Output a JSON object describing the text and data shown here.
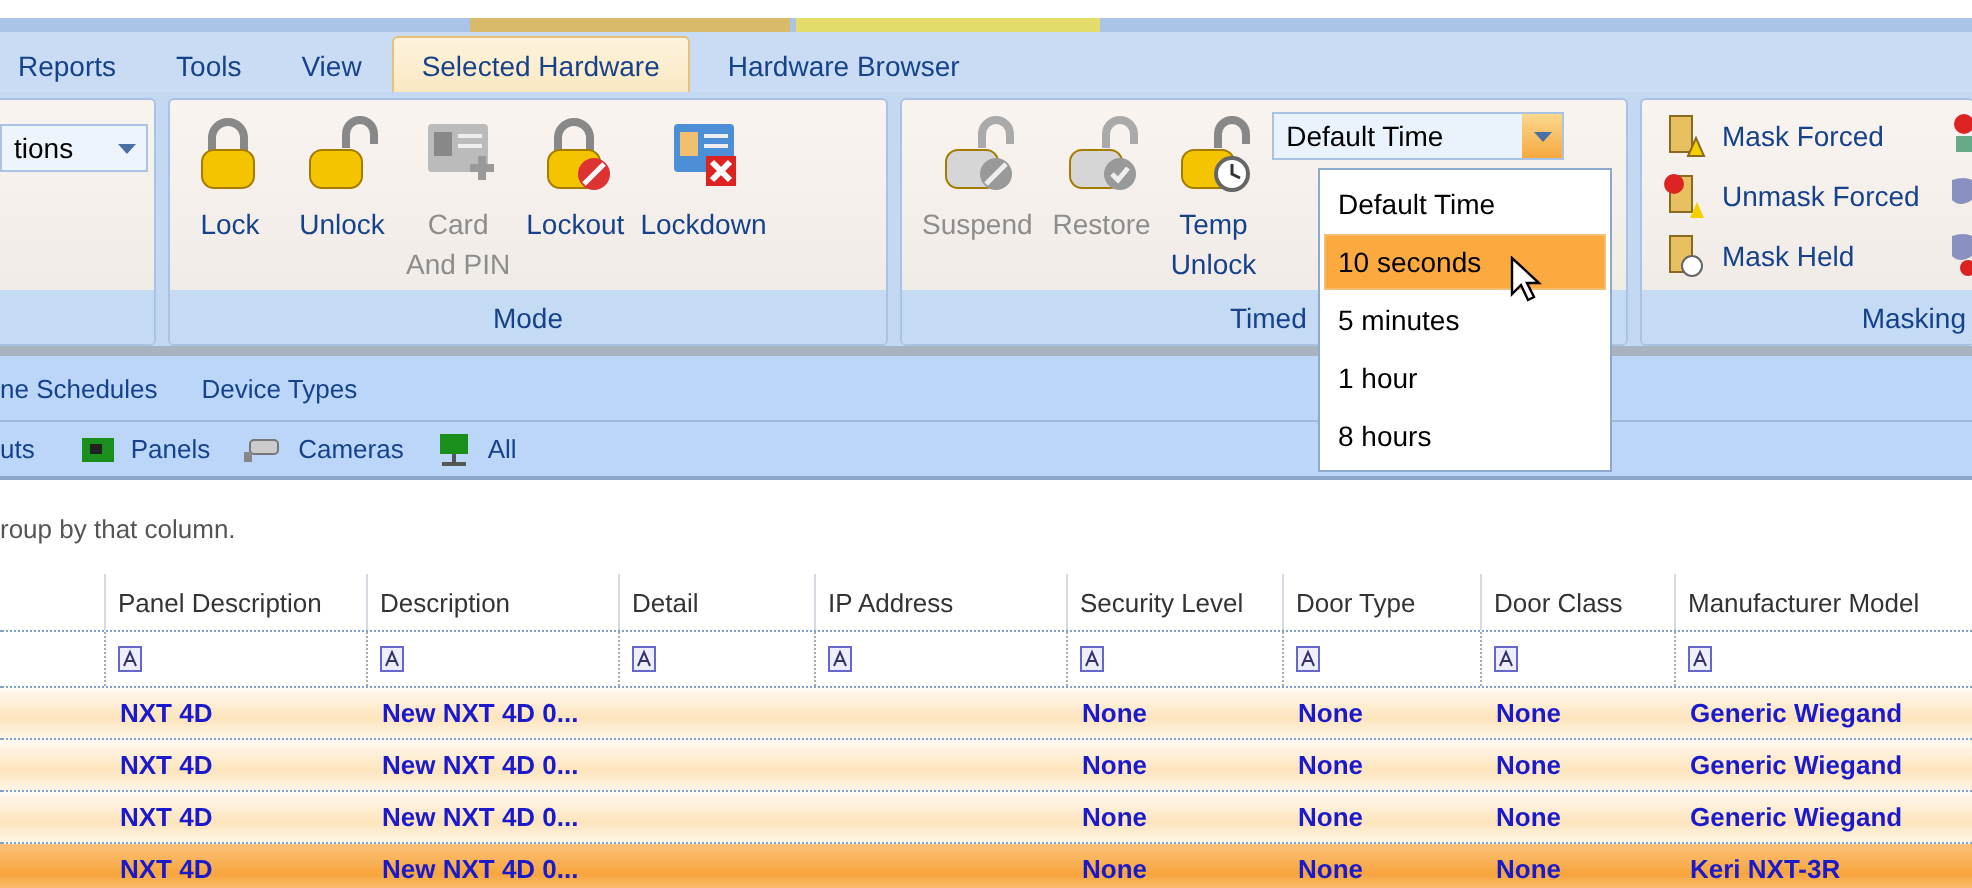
{
  "tabs": [
    {
      "label": "Reports",
      "selected": false
    },
    {
      "label": "Tools",
      "selected": false
    },
    {
      "label": "View",
      "selected": false
    },
    {
      "label": "Selected Hardware",
      "selected": true
    },
    {
      "label": "Hardware Browser",
      "selected": false
    }
  ],
  "ribbon": {
    "partial_dropdown": {
      "value": "tions"
    },
    "mode_group": {
      "label": "Mode",
      "buttons": [
        {
          "label": "Lock",
          "disabled": false
        },
        {
          "label": "Unlock",
          "disabled": false
        },
        {
          "label": "Card\nAnd PIN",
          "disabled": true
        },
        {
          "label": "Lockout",
          "disabled": false
        },
        {
          "label": "Lockdown",
          "disabled": false
        }
      ]
    },
    "timed_group": {
      "label": "Timed",
      "buttons": [
        {
          "label": "Suspend",
          "disabled": true
        },
        {
          "label": "Restore",
          "disabled": true
        },
        {
          "label": "Temp\nUnlock",
          "disabled": false
        }
      ],
      "dropdown": {
        "value": "Default Time",
        "open": true,
        "options": [
          {
            "label": "Default Time",
            "highlighted": false
          },
          {
            "label": "10 seconds",
            "highlighted": true
          },
          {
            "label": "5 minutes",
            "highlighted": false
          },
          {
            "label": "1 hour",
            "highlighted": false
          },
          {
            "label": "8 hours",
            "highlighted": false
          }
        ]
      }
    },
    "masking_group": {
      "label": "Masking",
      "items": [
        {
          "label": "Mask Forced"
        },
        {
          "label": "Unmask Forced"
        },
        {
          "label": "Mask Held"
        }
      ]
    }
  },
  "nav_tabs": [
    "ne Schedules",
    "Device Types"
  ],
  "toolbar": [
    "uts",
    "Panels",
    "Cameras",
    "All"
  ],
  "group_hint": "roup by that column.",
  "table": {
    "columns": [
      "Panel Description",
      "Description",
      "Detail",
      "IP Address",
      "Security Level",
      "Door Type",
      "Door Class",
      "Manufacturer Model"
    ],
    "rows": [
      {
        "cells": [
          "NXT 4D",
          "New NXT 4D 0...",
          "",
          "",
          "None",
          "None",
          "None",
          "Generic Wiegand"
        ],
        "selected": false
      },
      {
        "cells": [
          "NXT 4D",
          "New NXT 4D 0...",
          "",
          "",
          "None",
          "None",
          "None",
          "Generic Wiegand"
        ],
        "selected": false
      },
      {
        "cells": [
          "NXT 4D",
          "New NXT 4D 0...",
          "",
          "",
          "None",
          "None",
          "None",
          "Generic Wiegand"
        ],
        "selected": false
      },
      {
        "cells": [
          "NXT 4D",
          "New NXT 4D 0...",
          "",
          "",
          "None",
          "None",
          "None",
          "Keri NXT-3R"
        ],
        "selected": true
      }
    ]
  }
}
